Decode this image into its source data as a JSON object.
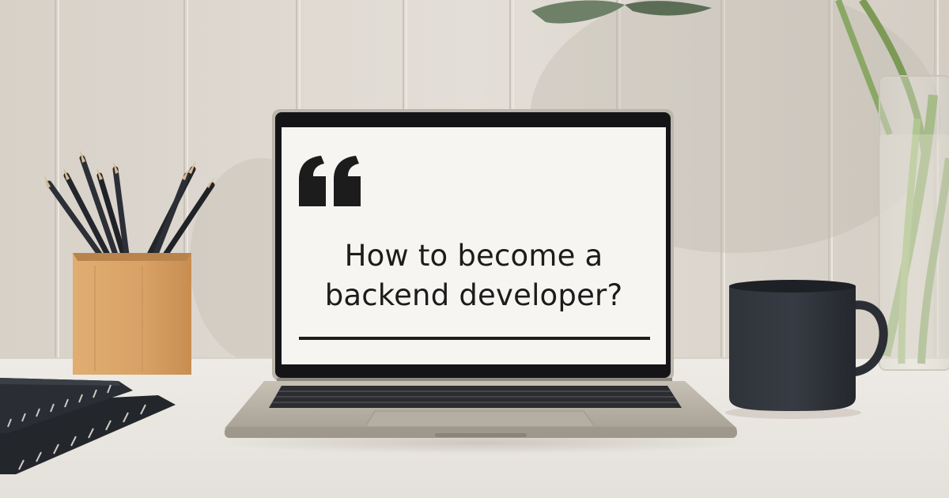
{
  "screen": {
    "heading_line1": "How to become a",
    "heading_line2": "backend developer?"
  },
  "colors": {
    "wall": "#ddd8d1",
    "desk": "#e9e6e0",
    "screen_background": "#f7f5f2",
    "text": "#1c1c1c",
    "pencil_holder": "#d9a66b",
    "mug": "#2a2d33",
    "laptop_body": "#bdb7ab"
  },
  "objects": [
    "pencil-holder",
    "pencils",
    "notebooks",
    "laptop",
    "coffee-mug",
    "plant-vase",
    "leaf"
  ]
}
